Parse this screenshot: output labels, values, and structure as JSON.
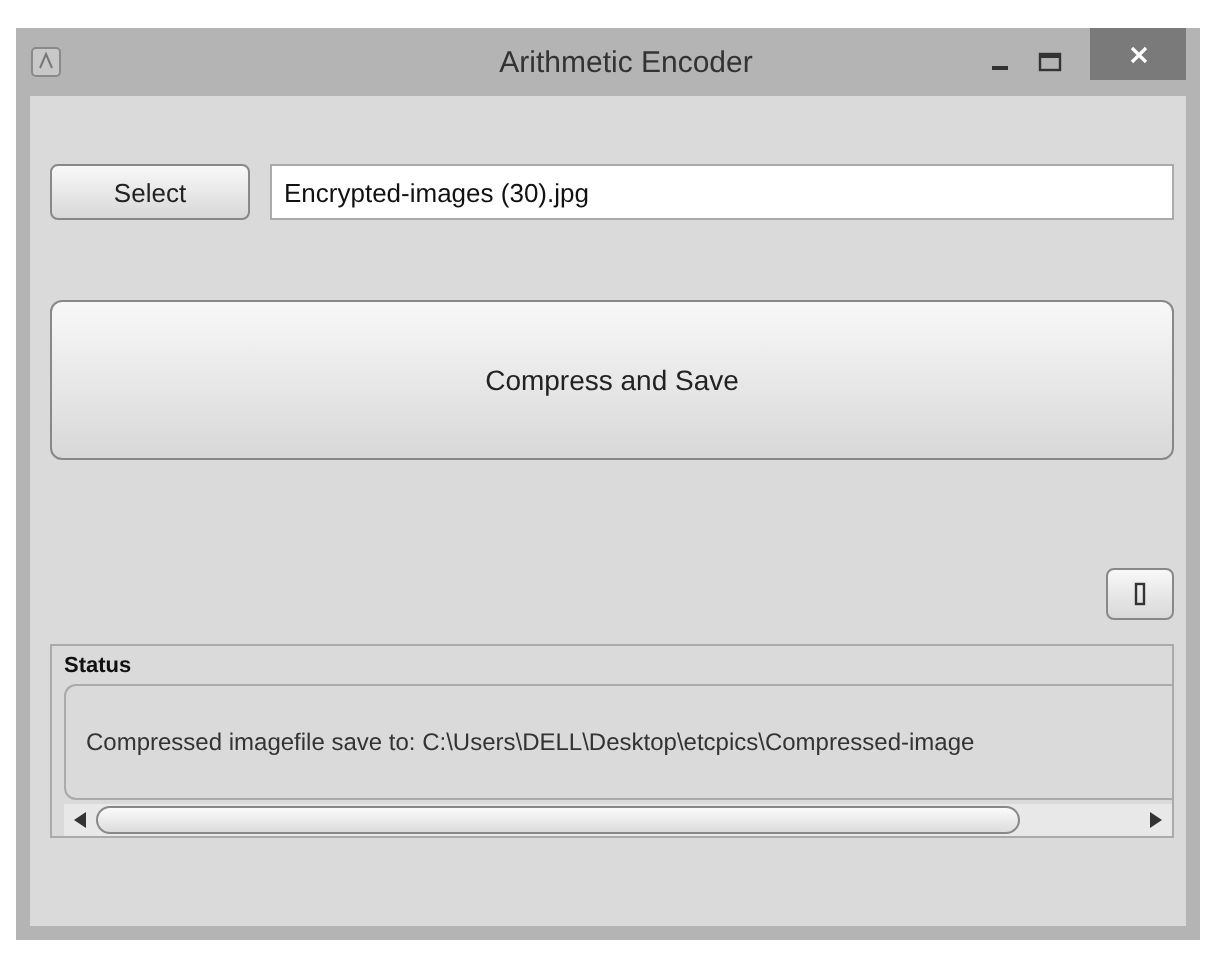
{
  "window": {
    "title": "Arithmetic Encoder"
  },
  "select_button": {
    "label": "Select"
  },
  "file_field": {
    "value": "Encrypted-images (30).jpg"
  },
  "compress_button": {
    "label": "Compress and Save"
  },
  "status": {
    "heading": "Status",
    "message": "Compressed imagefile save to: C:\\Users\\DELL\\Desktop\\etcpics\\Compressed-image"
  }
}
